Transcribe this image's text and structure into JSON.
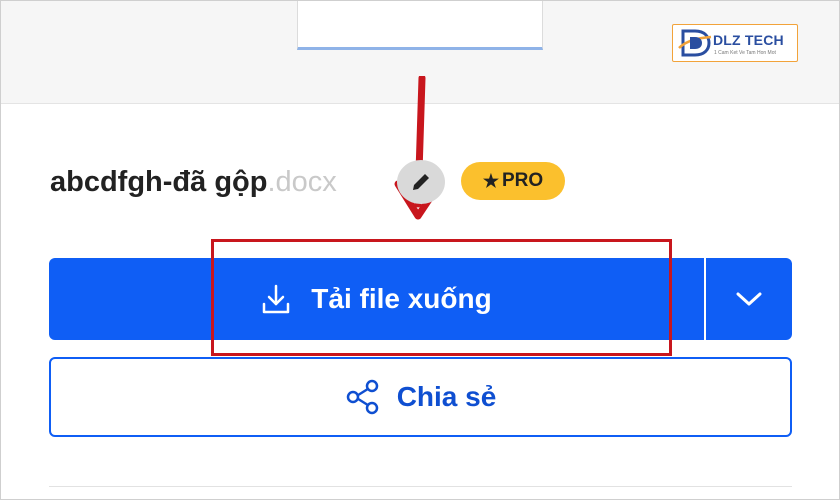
{
  "logo": {
    "brand": "DLZ TECH",
    "slogan": "1 Cam Ket Ve Tam Hon Mot"
  },
  "file": {
    "name": "abcdfgh-đã gộp",
    "extension": ".docx"
  },
  "badge": {
    "label": "PRO",
    "star": "★"
  },
  "actions": {
    "download_label": "Tải file xuống",
    "share_label": "Chia sẻ"
  },
  "colors": {
    "primary": "#0f5ef5",
    "badge": "#fbc02d",
    "annotation": "#c8161d"
  }
}
